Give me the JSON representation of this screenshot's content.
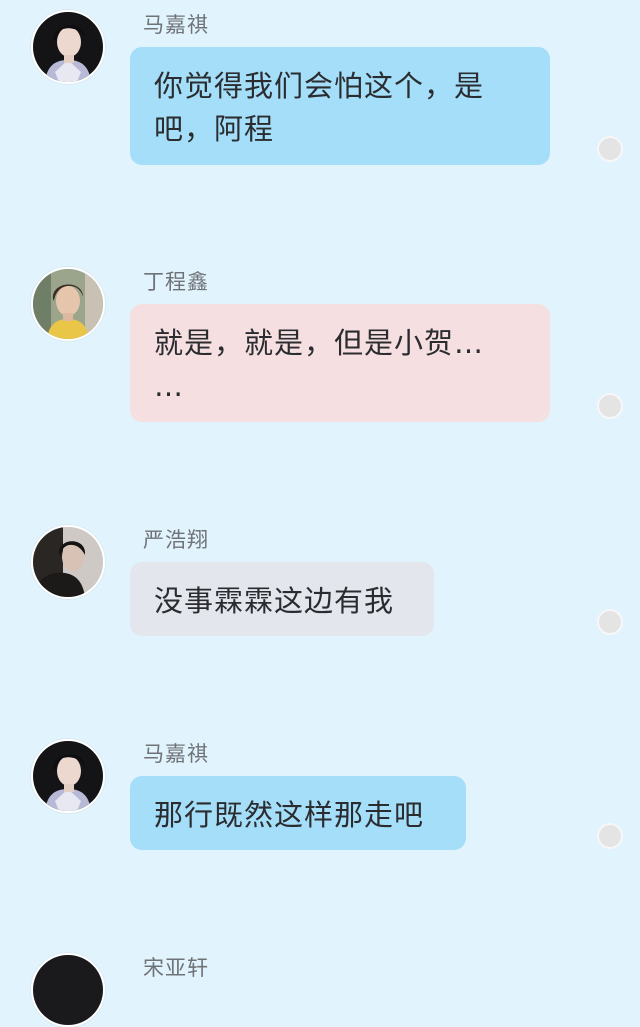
{
  "colors": {
    "background": "#e1f3fc",
    "bubble_blue": "#a5def9",
    "bubble_pink": "#f5dfe1",
    "bubble_gray": "#e3e6ec"
  },
  "messages": [
    {
      "sender": "马嘉祺",
      "avatar_icon": "avatar-majiaqi",
      "lines": [
        "你觉得我们会怕这个，是",
        "吧，阿程"
      ],
      "bubble_color": "#a5def9"
    },
    {
      "sender": "丁程鑫",
      "avatar_icon": "avatar-dingchengxin",
      "lines": [
        "就是，就是，但是小贺…",
        "…"
      ],
      "bubble_color": "#f5dfe1"
    },
    {
      "sender": "严浩翔",
      "avatar_icon": "avatar-yanhaoxiang",
      "lines": [
        "没事霖霖这边有我"
      ],
      "bubble_color": "#e3e6ec"
    },
    {
      "sender": "马嘉祺",
      "avatar_icon": "avatar-majiaqi",
      "lines": [
        "那行既然这样那走吧"
      ],
      "bubble_color": "#a5def9"
    },
    {
      "sender": "宋亚轩",
      "avatar_icon": "avatar-songyaxuan",
      "lines": [],
      "bubble_color": ""
    }
  ]
}
